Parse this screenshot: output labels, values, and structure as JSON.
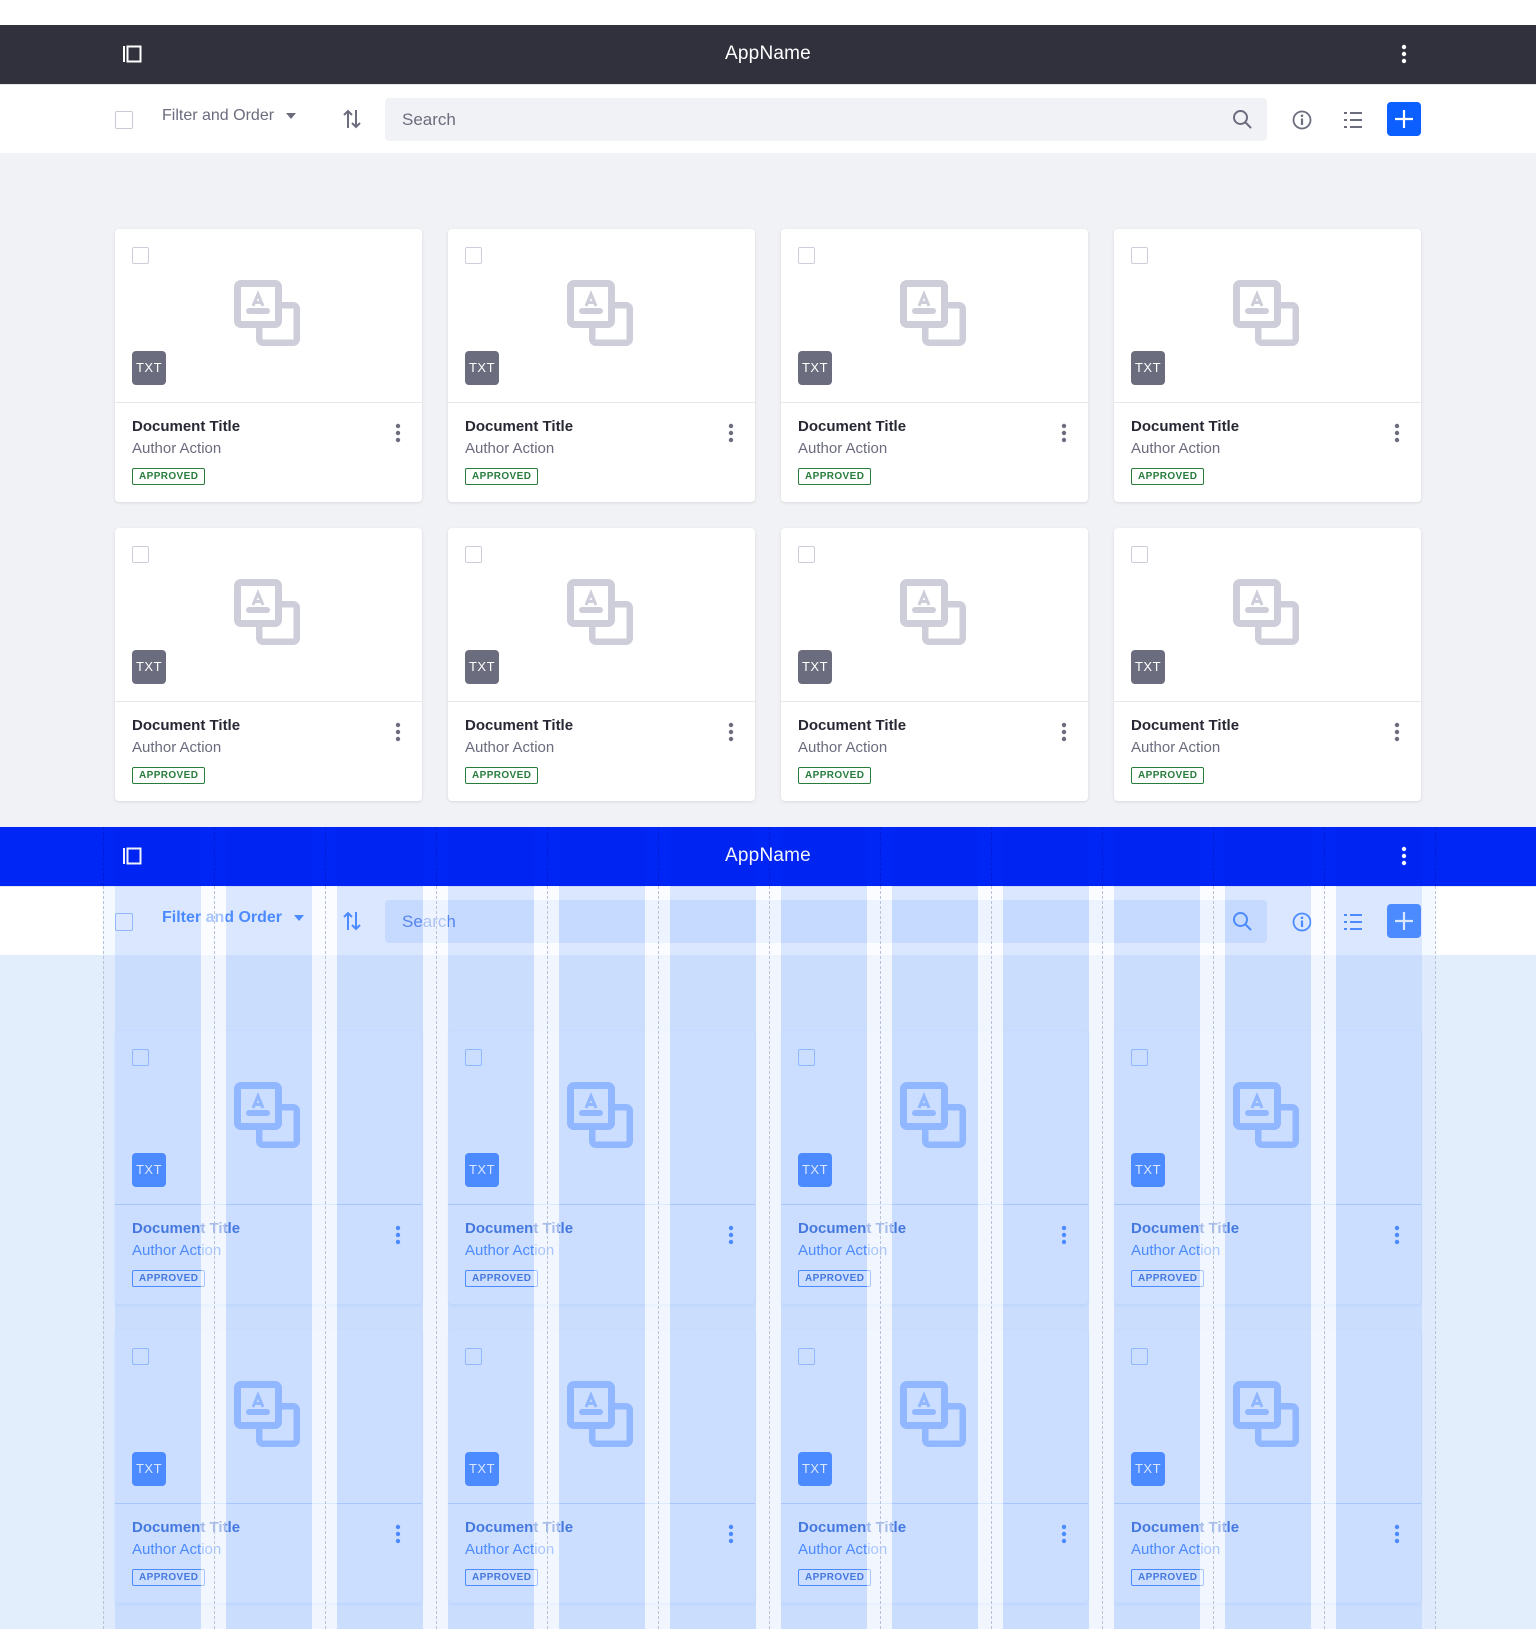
{
  "colors": {
    "appbar_default": "#30313d",
    "appbar_overlay": "#0026f5",
    "primary": "#0b5fff",
    "approved": "#287d3c",
    "background": "#f1f2f5"
  },
  "panels": [
    {
      "variant": "default",
      "appbar": {
        "title": "AppName",
        "left_icon": "sidebar-toggle-icon",
        "right_icon": "kebab-icon"
      },
      "toolbar": {
        "select_all_checked": false,
        "filter_label": "Filter and Order",
        "sort_icon": "sort-arrows-icon",
        "search_placeholder": "Search",
        "search_value": "",
        "info_icon": "info-icon",
        "view_icon": "list-view-icon",
        "add_icon": "plus-icon"
      },
      "cards": [
        {
          "type_label": "TXT",
          "title": "Document Title",
          "subtitle": "Author Action",
          "status": "APPROVED",
          "checked": false
        },
        {
          "type_label": "TXT",
          "title": "Document Title",
          "subtitle": "Author Action",
          "status": "APPROVED",
          "checked": false
        },
        {
          "type_label": "TXT",
          "title": "Document Title",
          "subtitle": "Author Action",
          "status": "APPROVED",
          "checked": false
        },
        {
          "type_label": "TXT",
          "title": "Document Title",
          "subtitle": "Author Action",
          "status": "APPROVED",
          "checked": false
        },
        {
          "type_label": "TXT",
          "title": "Document Title",
          "subtitle": "Author Action",
          "status": "APPROVED",
          "checked": false
        },
        {
          "type_label": "TXT",
          "title": "Document Title",
          "subtitle": "Author Action",
          "status": "APPROVED",
          "checked": false
        },
        {
          "type_label": "TXT",
          "title": "Document Title",
          "subtitle": "Author Action",
          "status": "APPROVED",
          "checked": false
        },
        {
          "type_label": "TXT",
          "title": "Document Title",
          "subtitle": "Author Action",
          "status": "APPROVED",
          "checked": false
        }
      ]
    },
    {
      "variant": "grid-overlay",
      "appbar": {
        "title": "AppName",
        "left_icon": "sidebar-toggle-icon",
        "right_icon": "kebab-icon"
      },
      "toolbar": {
        "select_all_checked": false,
        "filter_label": "Filter and Order",
        "sort_icon": "sort-arrows-icon",
        "search_placeholder": "Search",
        "search_value": "",
        "info_icon": "info-icon",
        "view_icon": "list-view-icon",
        "add_icon": "plus-icon"
      },
      "cards": [
        {
          "type_label": "TXT",
          "title": "Document Title",
          "subtitle": "Author Action",
          "status": "APPROVED",
          "checked": false
        },
        {
          "type_label": "TXT",
          "title": "Document Title",
          "subtitle": "Author Action",
          "status": "APPROVED",
          "checked": false
        },
        {
          "type_label": "TXT",
          "title": "Document Title",
          "subtitle": "Author Action",
          "status": "APPROVED",
          "checked": false
        },
        {
          "type_label": "TXT",
          "title": "Document Title",
          "subtitle": "Author Action",
          "status": "APPROVED",
          "checked": false
        },
        {
          "type_label": "TXT",
          "title": "Document Title",
          "subtitle": "Author Action",
          "status": "APPROVED",
          "checked": false
        },
        {
          "type_label": "TXT",
          "title": "Document Title",
          "subtitle": "Author Action",
          "status": "APPROVED",
          "checked": false
        },
        {
          "type_label": "TXT",
          "title": "Document Title",
          "subtitle": "Author Action",
          "status": "APPROVED",
          "checked": false
        },
        {
          "type_label": "TXT",
          "title": "Document Title",
          "subtitle": "Author Action",
          "status": "APPROVED",
          "checked": false
        }
      ],
      "grid": {
        "columns": 12
      }
    }
  ]
}
